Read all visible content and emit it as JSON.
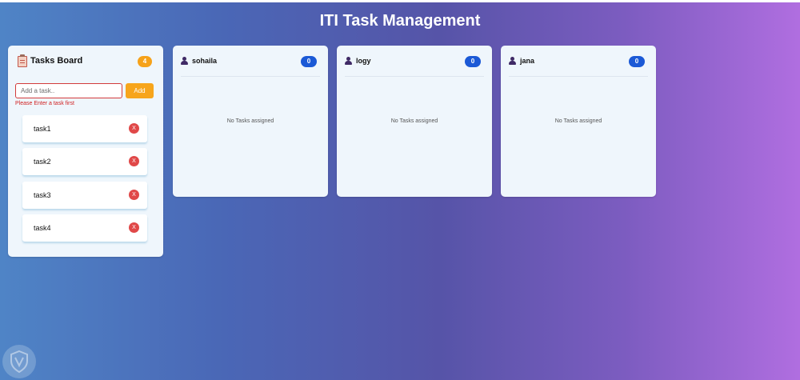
{
  "app": {
    "title": "ITI Task Management"
  },
  "board": {
    "icon": "clipboard-icon",
    "title": "Tasks Board",
    "count": "4",
    "input_placeholder": "Add a task..",
    "input_value": "",
    "add_label": "Add",
    "error": "Please Enter a task first",
    "tasks": [
      {
        "label": "task1",
        "delete": "X"
      },
      {
        "label": "task2",
        "delete": "X"
      },
      {
        "label": "task3",
        "delete": "X"
      },
      {
        "label": "task4",
        "delete": "X"
      }
    ]
  },
  "users": [
    {
      "icon": "user-icon",
      "name": "sohaila",
      "count": "0",
      "empty": "No Tasks assigned"
    },
    {
      "icon": "user-icon",
      "name": "logy",
      "count": "0",
      "empty": "No Tasks assigned"
    },
    {
      "icon": "user-icon",
      "name": "jana",
      "count": "0",
      "empty": "No Tasks assigned"
    }
  ],
  "colors": {
    "accent_orange": "#f7a51b",
    "badge_blue": "#1b59d6",
    "error_red": "#d01f1f",
    "delete_red": "#e04848",
    "card_bg": "#eff6fc"
  }
}
